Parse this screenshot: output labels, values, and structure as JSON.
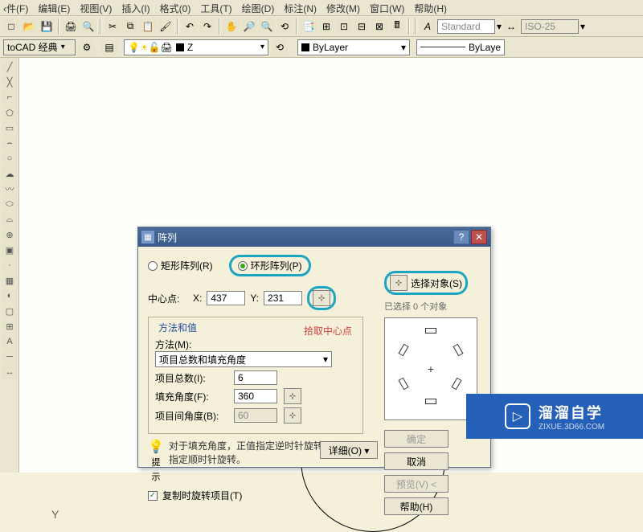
{
  "menu": {
    "file": "‹件(F)",
    "edit": "编辑(E)",
    "view": "视图(V)",
    "insert": "插入(I)",
    "format": "格式(0)",
    "tools": "工具(T)",
    "draw": "绘图(D)",
    "dim": "标注(N)",
    "modify": "修改(M)",
    "window": "窗口(W)",
    "help": "帮助(H)"
  },
  "workspace": {
    "name": "toCAD 经典"
  },
  "style": {
    "text": "Standard",
    "dim": "ISO-25"
  },
  "layer": {
    "current": "Z",
    "bylayer": "ByLayer",
    "bylayer2": "ByLaye"
  },
  "dialog": {
    "title": "阵列",
    "rect_array": "矩形阵列(R)",
    "polar_array": "环形阵列(P)",
    "select_obj": "选择对象(S)",
    "selected_count": "已选择 0 个对象",
    "center": "中心点:",
    "x_label": "X:",
    "y_label": "Y:",
    "x_val": "437",
    "y_val": "231",
    "annotation": "拾取中心点",
    "method_group": "方法和值",
    "method_label": "方法(M):",
    "method_value": "项目总数和填充角度",
    "items_label": "项目总数(I):",
    "items_val": "6",
    "fill_angle_label": "填充角度(F):",
    "fill_angle_val": "360",
    "item_angle_label": "项目间角度(B):",
    "item_angle_val": "60",
    "tip_label": "提示",
    "tip_text": "对于填充角度，正值指定逆时针旋转，负值指定顺时针旋转。",
    "rotate_copy": "复制时旋转项目(T)",
    "details": "详细(O)  ▾",
    "ok": "确定",
    "cancel": "取消",
    "preview": "预览(V) <",
    "help": "帮助(H)"
  },
  "axis": {
    "y": "Y"
  },
  "watermark": {
    "brand": "溜溜自学",
    "url": "ZIXUE.3D66.COM"
  }
}
